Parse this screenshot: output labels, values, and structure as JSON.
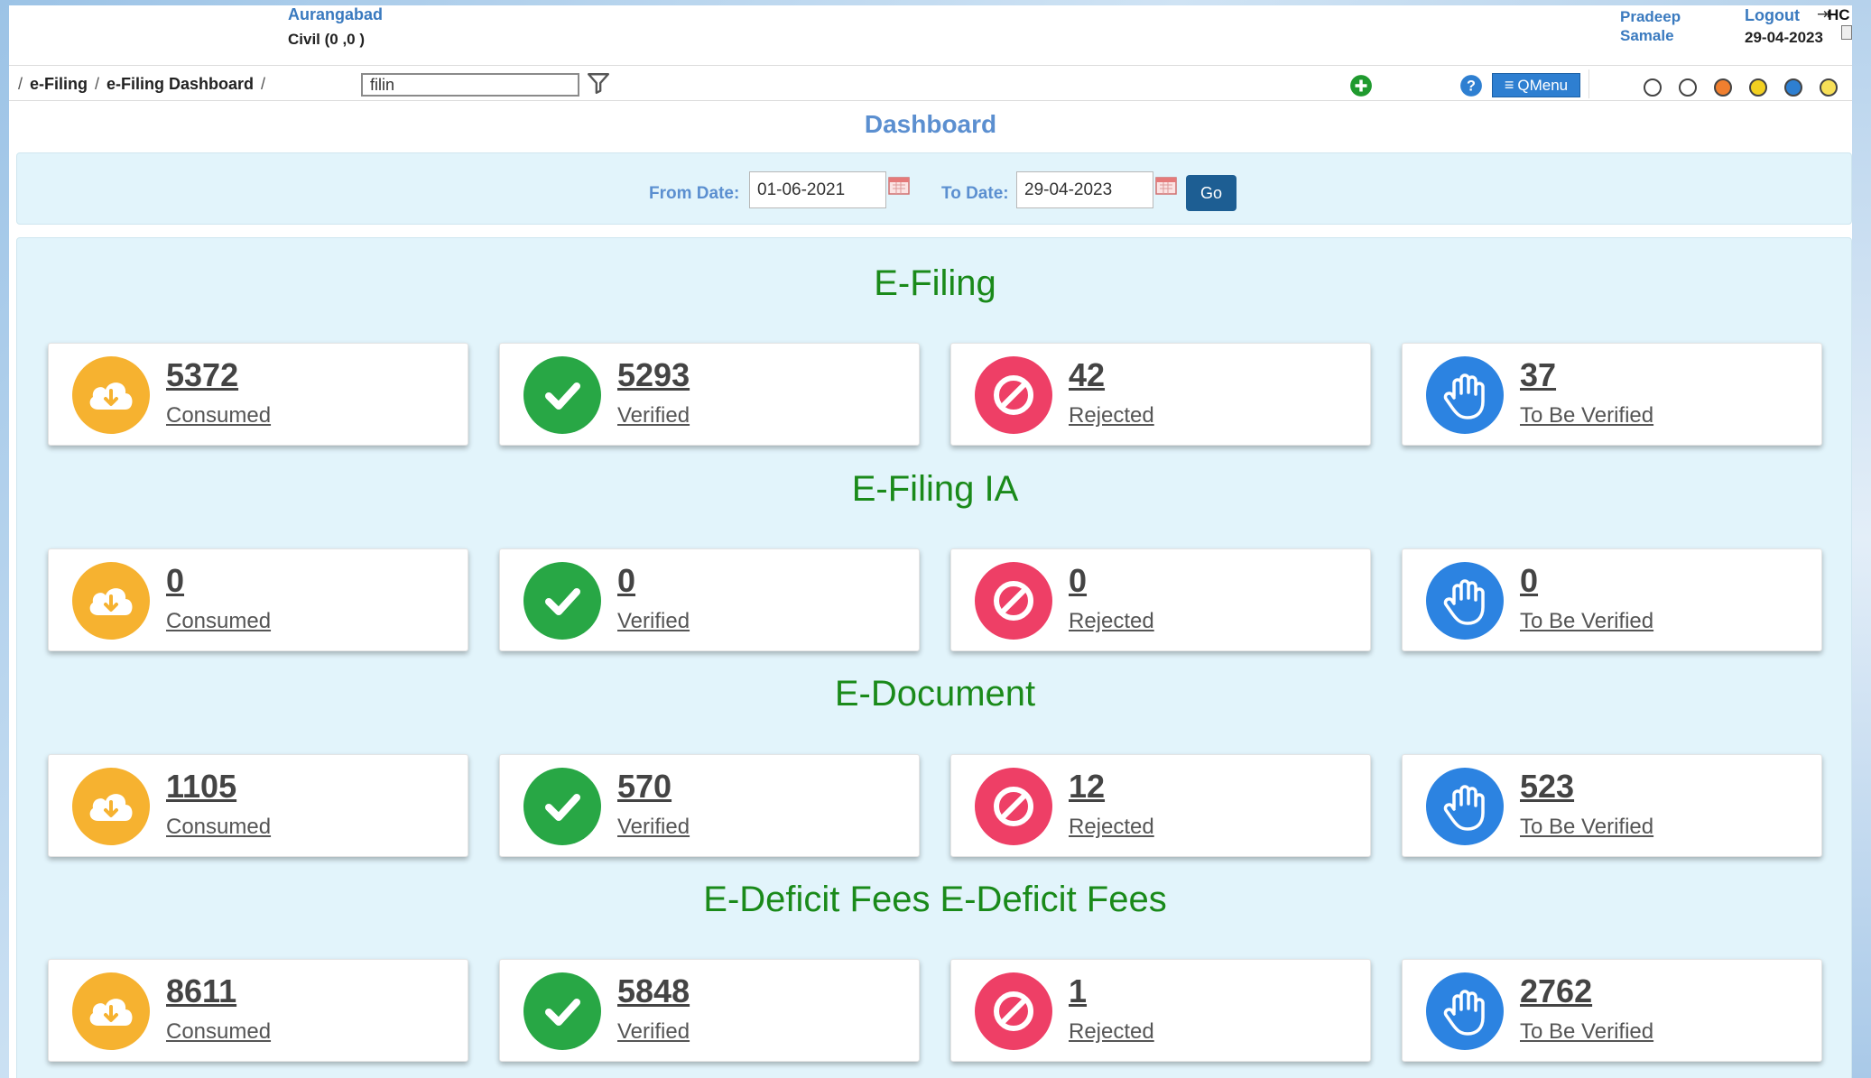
{
  "header": {
    "court_name": "Aurangabad",
    "court_sub": "Civil (0 ,0 )",
    "user_name": "Pradeep Samale",
    "logout_label": "Logout",
    "hc_label": "HC",
    "date": "29-04-2023"
  },
  "nav": {
    "breadcrumb": [
      "e-Filing",
      "e-Filing Dashboard"
    ],
    "search_value": "filin",
    "qmenu_label": "QMenu",
    "theme_colors": [
      "#ffffff",
      "#ffffff",
      "#f07f2f",
      "#f2d021",
      "#2e7fd1",
      "#f7df57"
    ]
  },
  "page_title": "Dashboard",
  "date_filter": {
    "from_label": "From Date:",
    "from_value": "01-06-2021",
    "to_label": "To Date:",
    "to_value": "29-04-2023",
    "go_label": "Go"
  },
  "sections": [
    {
      "title": "E-Filing",
      "cards": [
        {
          "count": "5372",
          "label": "Consumed"
        },
        {
          "count": "5293",
          "label": "Verified"
        },
        {
          "count": "42",
          "label": "Rejected"
        },
        {
          "count": "37",
          "label": "To Be Verified"
        }
      ]
    },
    {
      "title": "E-Filing IA",
      "cards": [
        {
          "count": "0",
          "label": "Consumed"
        },
        {
          "count": "0",
          "label": "Verified"
        },
        {
          "count": "0",
          "label": "Rejected"
        },
        {
          "count": "0",
          "label": "To Be Verified"
        }
      ]
    },
    {
      "title": "E-Document",
      "cards": [
        {
          "count": "1105",
          "label": "Consumed"
        },
        {
          "count": "570",
          "label": "Verified"
        },
        {
          "count": "12",
          "label": "Rejected"
        },
        {
          "count": "523",
          "label": "To Be Verified"
        }
      ]
    },
    {
      "title": "E-Deficit Fees E-Deficit Fees",
      "cards": [
        {
          "count": "8611",
          "label": "Consumed"
        },
        {
          "count": "5848",
          "label": "Verified"
        },
        {
          "count": "1",
          "label": "Rejected"
        },
        {
          "count": "2762",
          "label": "To Be Verified"
        }
      ]
    }
  ],
  "colors": {
    "accent": "#5b8fd0",
    "section_title": "#1a8a1a",
    "consumed": "#f6b230",
    "verified": "#28a745",
    "rejected": "#ee3f66",
    "to_be_verified": "#2c83e1"
  },
  "icons": {
    "consumed": "cloud-download-icon",
    "verified": "check-icon",
    "rejected": "ban-icon",
    "to_be_verified": "hand-icon"
  }
}
